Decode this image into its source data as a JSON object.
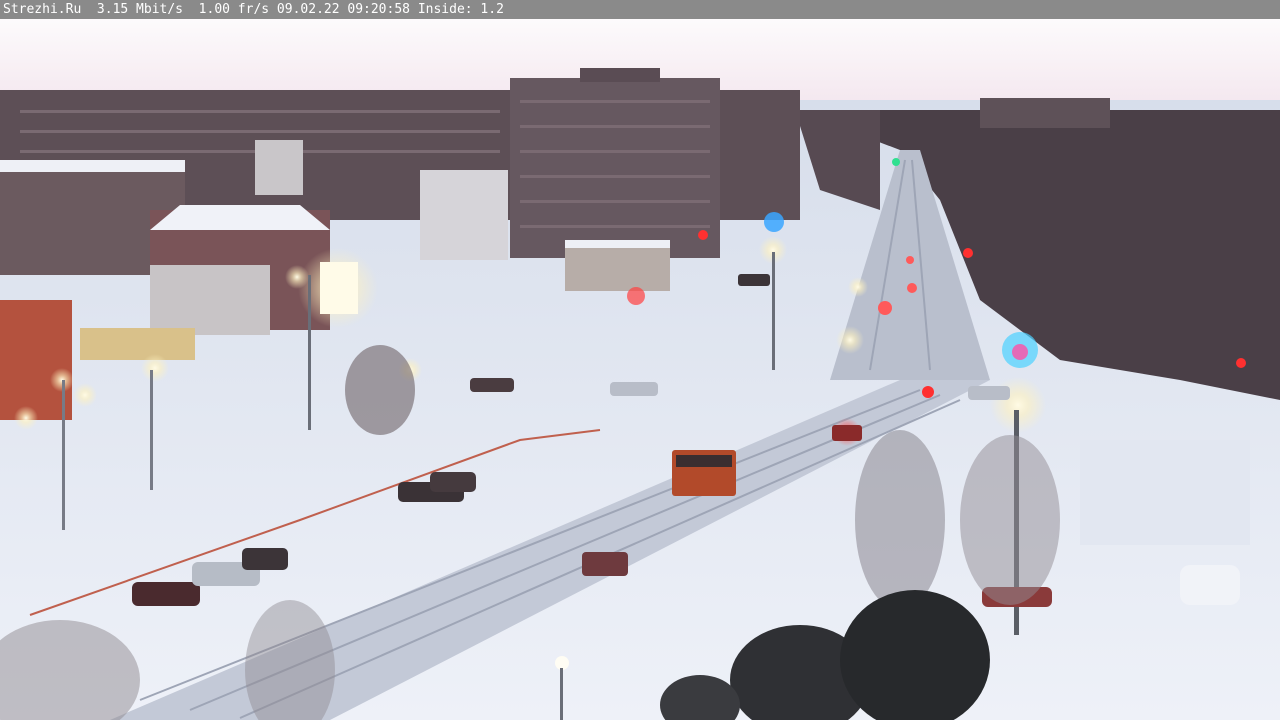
{
  "camera_view": {
    "osd": {
      "text": "Strezhi.Ru  3.15 Mbit/s  1.00 fr/s 09.02.22 09:20:58 Inside: 1.2"
    },
    "scene_description_icon": "webcam-frame-icon",
    "colors": {
      "osd_background": "#808080",
      "osd_text": "#ffffff",
      "sky": "#fbf6f8",
      "snow": "#e7ebf4",
      "buildings": "#5b4e55",
      "streetlight": "#fff4c6",
      "tail_light": "#ff3a3a"
    }
  }
}
